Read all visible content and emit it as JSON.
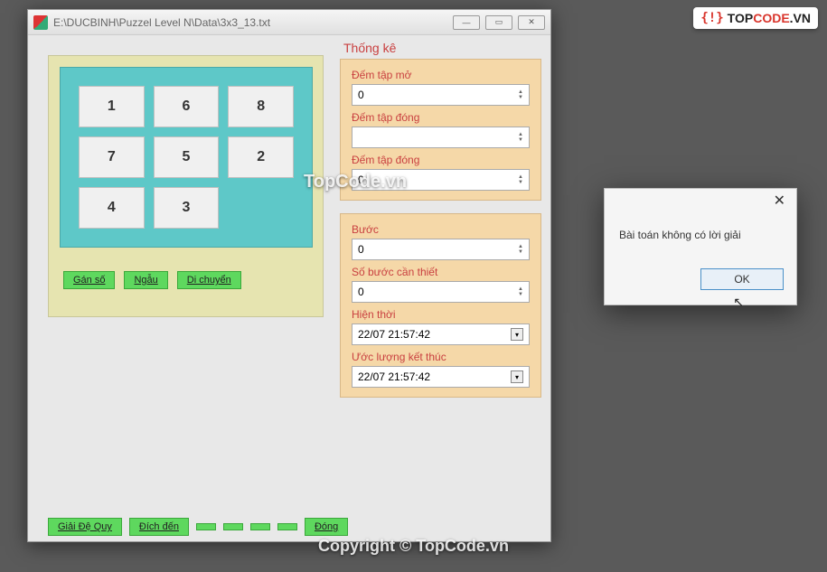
{
  "logo": {
    "bracket": "{!}",
    "top": "TOP",
    "code": "CODE",
    "vn": ".VN"
  },
  "window": {
    "title": "E:\\DUCBINH\\Puzzel Level N\\Data\\3x3_13.txt",
    "controls": {
      "min": "—",
      "max": "▭",
      "close": "✕"
    }
  },
  "puzzle": {
    "tiles": [
      "1",
      "6",
      "8",
      "7",
      "5",
      "2",
      "4",
      "3",
      ""
    ],
    "buttons": {
      "assign": "Gán số",
      "mix": "Ngẫu",
      "move": "Di chuyển"
    }
  },
  "stats": {
    "title": "Thống kê",
    "group1": {
      "open_label": "Đếm tập mở",
      "open_val": "0",
      "closed_label": "Đếm tập đóng",
      "closed_val": "",
      "closed2_label": "Đếm tập đóng",
      "closed2_val": "0"
    },
    "group2": {
      "step_label": "Bước",
      "step_val": "0",
      "needed_label": "Số bước cần thiết",
      "needed_val": "0",
      "current_label": "Hiện thời",
      "current_val": "22/07 21:57:42",
      "estimate_label": "Ước lượng kết thúc",
      "estimate_val": "22/07 21:57:42"
    }
  },
  "bottom_buttons": {
    "b1": "Giải Đệ Quy",
    "b2": "Đích đến",
    "b3": "  ",
    "b4": "  ",
    "b5": "  ",
    "b6": "  ",
    "b7": "Đóng"
  },
  "dialog": {
    "message": "Bài toán không có lời giải",
    "ok": "OK"
  },
  "watermarks": {
    "center": "TopCode.vn",
    "bottom": "Copyright © TopCode.vn"
  }
}
